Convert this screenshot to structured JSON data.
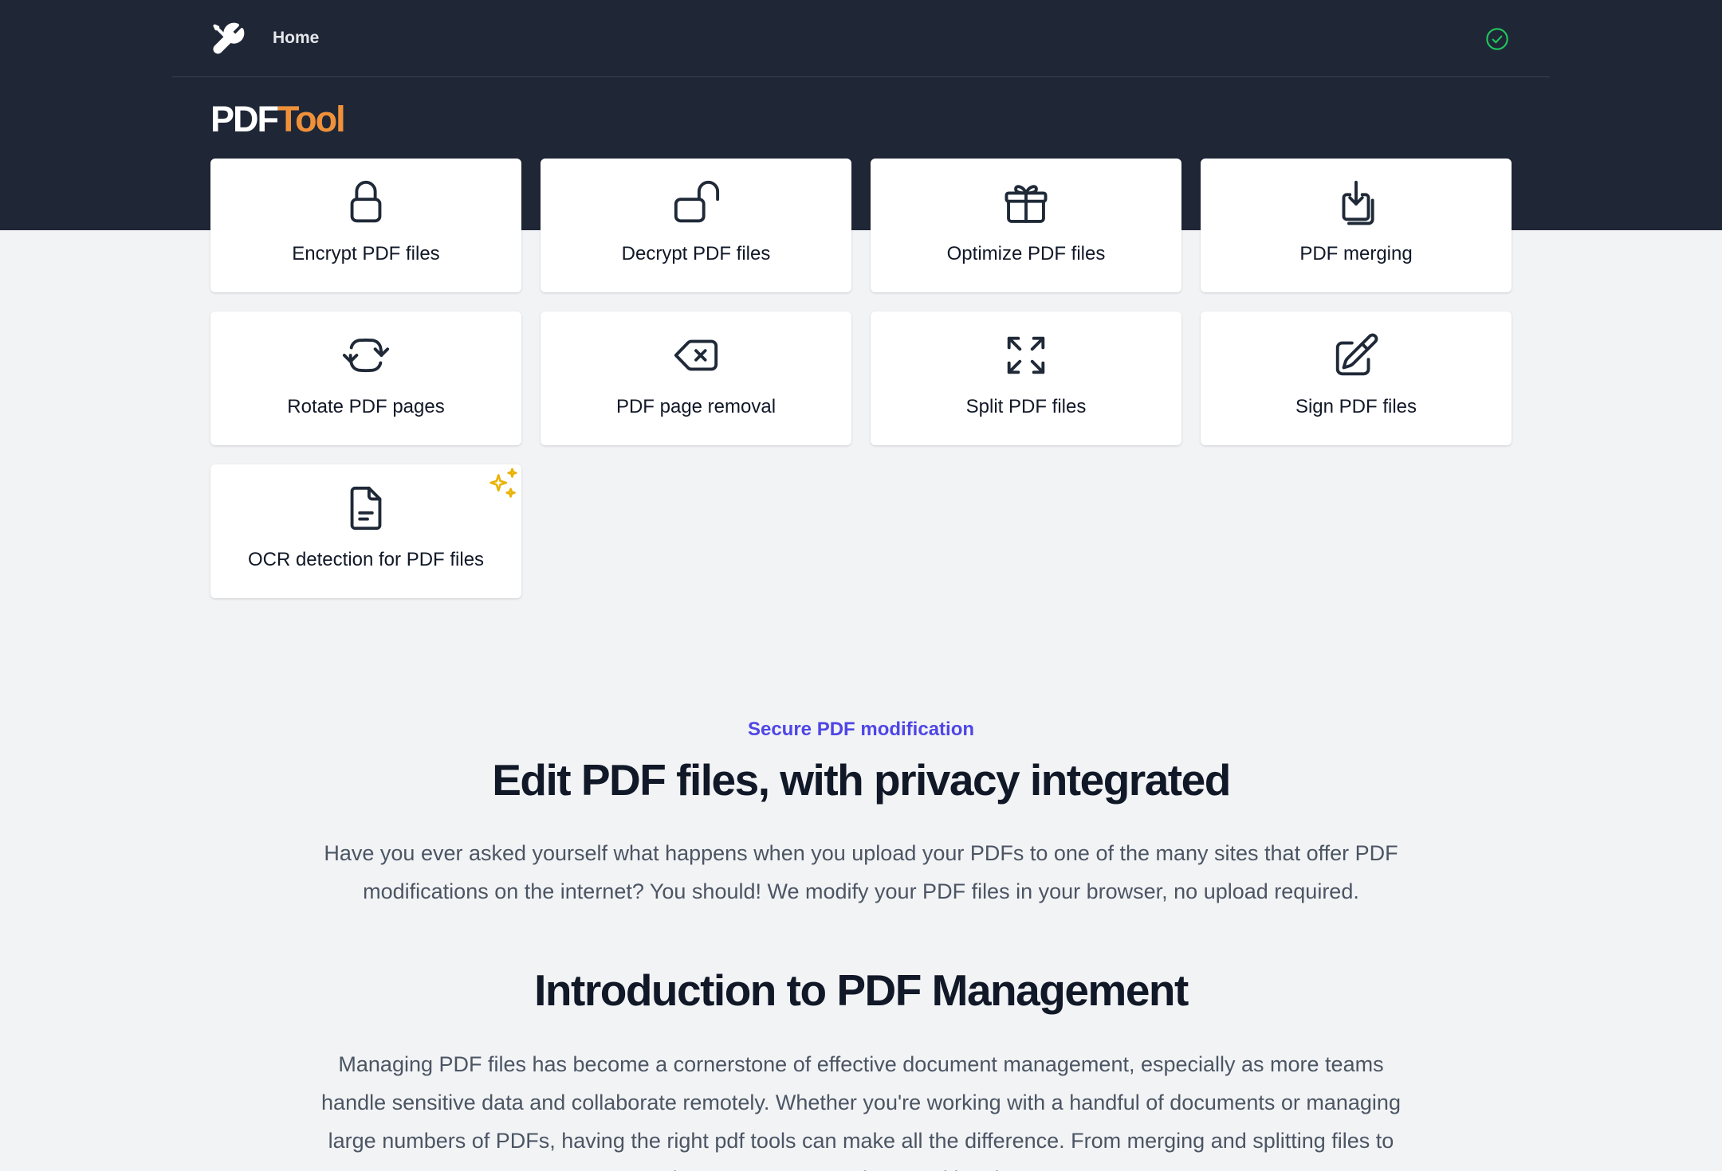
{
  "nav": {
    "home_label": "Home",
    "logo_icon": "wrench-screwdriver-icon",
    "status_icon": "check-circle-icon",
    "status_color": "#22c55e"
  },
  "brand": {
    "part1": "PDF",
    "part2": "Tool",
    "part1_color": "#ffffff",
    "part2_color": "#f0913a"
  },
  "tools": [
    {
      "label": "Encrypt PDF files",
      "icon": "lock-closed-icon"
    },
    {
      "label": "Decrypt PDF files",
      "icon": "lock-open-icon"
    },
    {
      "label": "Optimize PDF files",
      "icon": "gift-icon"
    },
    {
      "label": "PDF merging",
      "icon": "merge-download-icon"
    },
    {
      "label": "Rotate PDF pages",
      "icon": "rotate-arrows-icon"
    },
    {
      "label": "PDF page removal",
      "icon": "backspace-icon"
    },
    {
      "label": "Split PDF files",
      "icon": "expand-arrows-icon"
    },
    {
      "label": "Sign PDF files",
      "icon": "pencil-square-icon"
    },
    {
      "label": "OCR detection for PDF files",
      "icon": "document-text-icon",
      "badge": "sparkles-icon"
    }
  ],
  "intro": {
    "eyebrow": "Secure PDF modification",
    "title": "Edit PDF files, with privacy integrated",
    "text": "Have you ever asked yourself what happens when you upload your PDFs to one of the many sites that offer PDF modifications on the internet? You should! We modify your PDF files in your browser, no upload required."
  },
  "article": {
    "title": "Introduction to PDF Management",
    "text": "Managing PDF files has become a cornerstone of effective document management, especially as more teams handle sensitive data and collaborate remotely. Whether you're working with a handful of documents or managing large numbers of PDFs, having the right pdf tools can make all the difference. From merging and splitting files to rotating pages or protecting sensitive documents"
  },
  "colors": {
    "header_bg": "#1f2737",
    "page_bg": "#f2f3f5",
    "accent": "#4f46e5",
    "sparkle": "#eab308"
  }
}
